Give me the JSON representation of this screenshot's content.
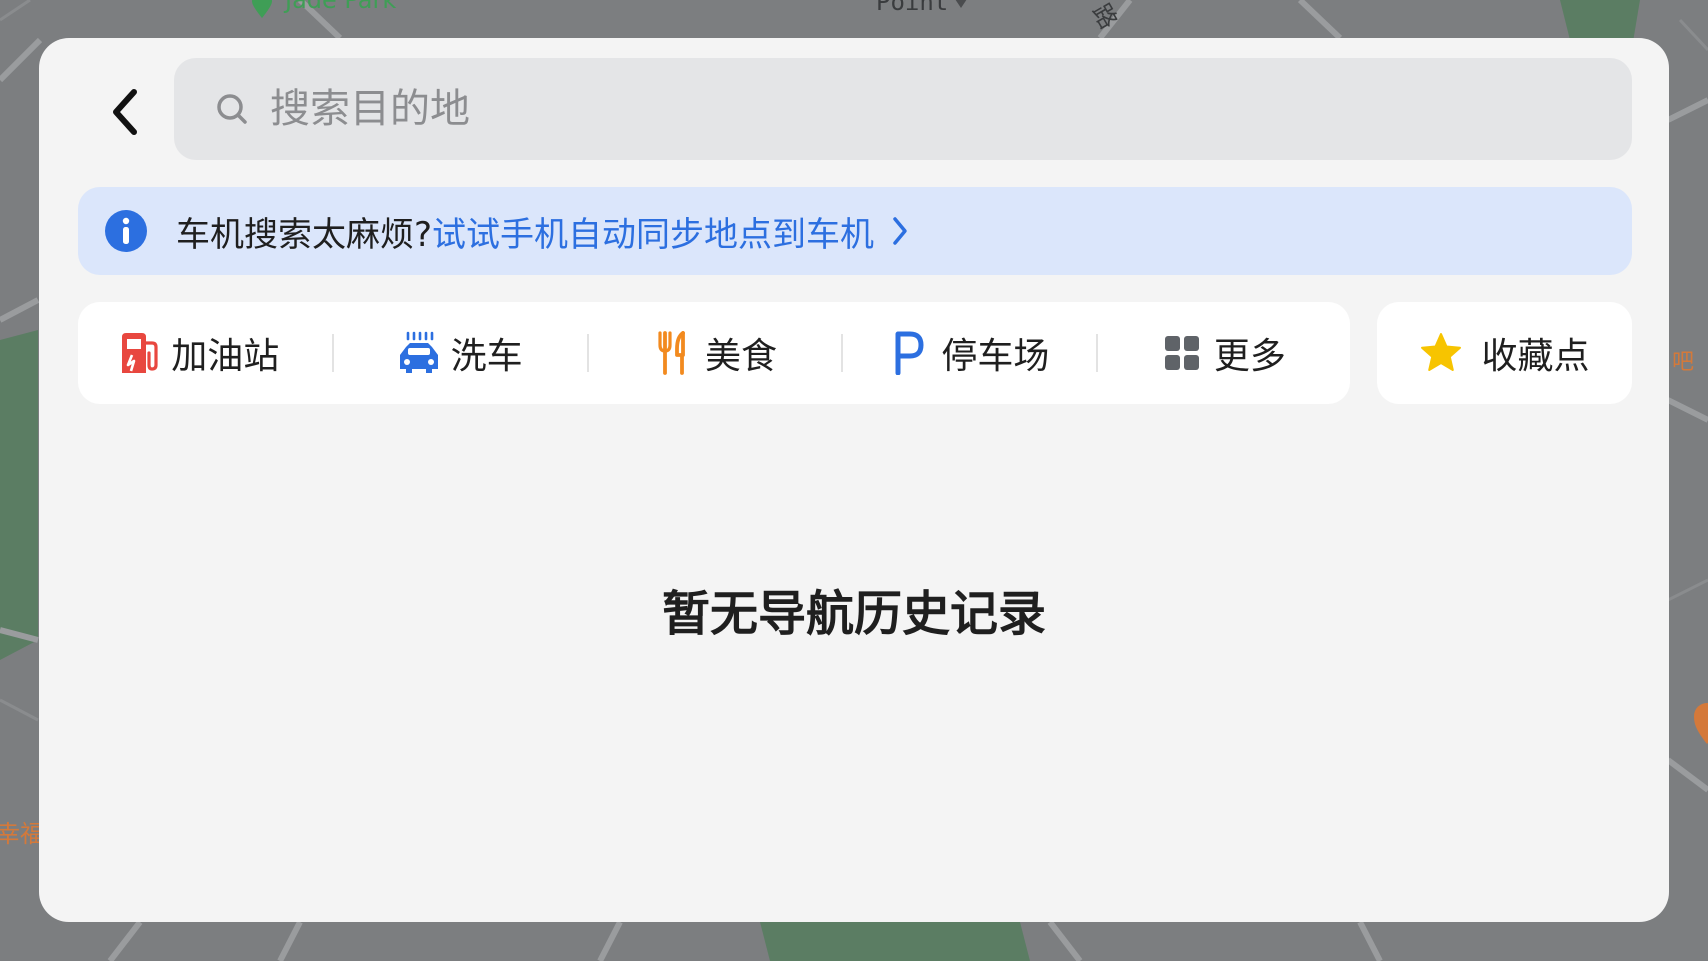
{
  "map": {
    "labels": {
      "poi_top_left": "Jade Park",
      "poi_top_mid": "Point",
      "road_top": "路",
      "poi_right": "吧",
      "poi_left": "幸福"
    }
  },
  "header": {
    "search_placeholder": "搜索目的地",
    "search_value": ""
  },
  "sync_banner": {
    "lead": "车机搜索太麻烦?",
    "link": "试试手机自动同步地点到车机"
  },
  "categories": [
    {
      "label": "加油站",
      "icon": "gas-station-icon",
      "color": "#e8473f"
    },
    {
      "label": "洗车",
      "icon": "car-wash-icon",
      "color": "#2c6fe0"
    },
    {
      "label": "美食",
      "icon": "food-icon",
      "color": "#f28a1f"
    },
    {
      "label": "停车场",
      "icon": "parking-icon",
      "color": "#2c6fe0"
    },
    {
      "label": "更多",
      "icon": "more-grid-icon",
      "color": "#5f6368"
    }
  ],
  "favorites": {
    "label": "收藏点",
    "icon": "star-icon",
    "color": "#f7c400"
  },
  "empty_state": "暂无导航历史记录",
  "colors": {
    "panel_bg": "#f4f4f4",
    "accent_blue": "#2c6fe0",
    "banner_bg": "#dbe6fb",
    "search_bg": "#e4e5e7"
  }
}
